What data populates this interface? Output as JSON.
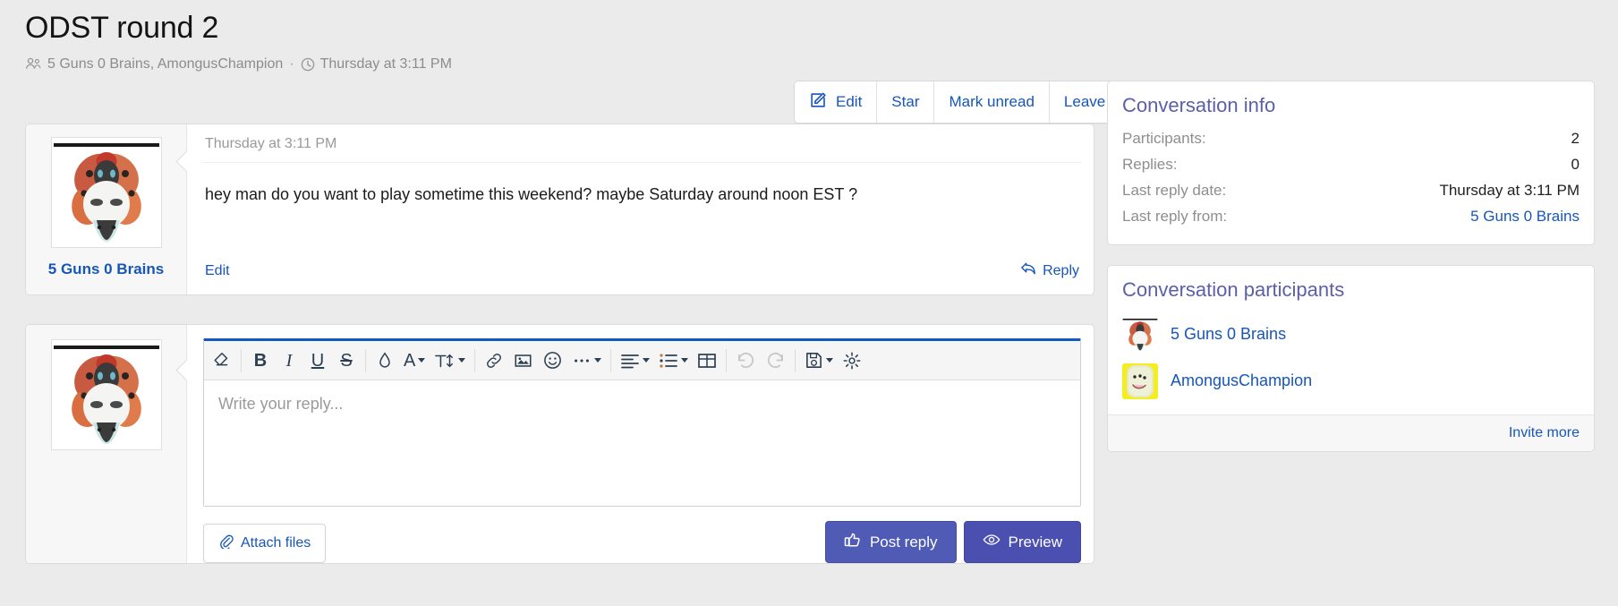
{
  "header": {
    "title": "ODST round 2",
    "participants_icon": "people-icon",
    "participants_text": "5 Guns 0 Brains, AmongusChampion",
    "separator": "·",
    "clock_icon": "clock-icon",
    "timestamp": "Thursday at 3:11 PM"
  },
  "actionbar": {
    "buttons": [
      {
        "label": "Edit",
        "icon": "edit-pencil-icon"
      },
      {
        "label": "Star",
        "icon": ""
      },
      {
        "label": "Mark unread",
        "icon": ""
      },
      {
        "label": "Leave",
        "icon": ""
      }
    ]
  },
  "message": {
    "author": "5 Guns 0 Brains",
    "avatar": "volcarona-moth-avatar",
    "date": "Thursday at 3:11 PM",
    "text": "hey man do you want to play sometime this weekend? maybe Saturday around noon EST ?",
    "edit_label": "Edit",
    "reply_label": "Reply",
    "reply_icon": "reply-arrow-icon"
  },
  "reply_editor": {
    "avatar": "volcarona-moth-avatar",
    "placeholder": "Write your reply...",
    "toolbar": [
      {
        "name": "remove-formatting-icon",
        "glyph": "eraser",
        "caret": false
      },
      {
        "name": "bold-icon",
        "glyph": "B",
        "caret": false
      },
      {
        "name": "italic-icon",
        "glyph": "I",
        "caret": false
      },
      {
        "name": "underline-icon",
        "glyph": "U",
        "caret": false
      },
      {
        "name": "strikethrough-icon",
        "glyph": "S",
        "caret": false
      },
      {
        "name": "text-color-icon",
        "glyph": "droplet",
        "caret": false
      },
      {
        "name": "font-family-icon",
        "glyph": "A",
        "caret": true
      },
      {
        "name": "font-size-icon",
        "glyph": "T",
        "caret": true
      },
      {
        "name": "insert-link-icon",
        "glyph": "link",
        "caret": false
      },
      {
        "name": "insert-image-icon",
        "glyph": "image",
        "caret": false
      },
      {
        "name": "insert-smilie-icon",
        "glyph": "smiley",
        "caret": false
      },
      {
        "name": "more-options-icon",
        "glyph": "ellipsis",
        "caret": true
      },
      {
        "name": "text-align-icon",
        "glyph": "align",
        "caret": true
      },
      {
        "name": "list-icon",
        "glyph": "list",
        "caret": true
      },
      {
        "name": "insert-table-icon",
        "glyph": "table",
        "caret": false
      },
      {
        "name": "undo-icon",
        "glyph": "undo",
        "caret": false,
        "disabled": true
      },
      {
        "name": "redo-icon",
        "glyph": "redo",
        "caret": false,
        "disabled": true
      },
      {
        "name": "drafts-icon",
        "glyph": "floppy",
        "caret": true
      },
      {
        "name": "editor-settings-icon",
        "glyph": "gear",
        "caret": false
      }
    ],
    "attach_label": "Attach files",
    "attach_icon": "paperclip-icon",
    "post_label": "Post reply",
    "post_icon": "thumbs-up-icon",
    "preview_label": "Preview",
    "preview_icon": "eye-icon"
  },
  "sidebar": {
    "info_card": {
      "title": "Conversation info",
      "rows": [
        {
          "key": "Participants:",
          "value": "2",
          "is_link": false
        },
        {
          "key": "Replies:",
          "value": "0",
          "is_link": false
        },
        {
          "key": "Last reply date:",
          "value": "Thursday at 3:11 PM",
          "is_link": false
        },
        {
          "key": "Last reply from:",
          "value": "5 Guns 0 Brains",
          "is_link": true
        }
      ]
    },
    "participants_card": {
      "title": "Conversation participants",
      "members": [
        {
          "name": "5 Guns 0 Brains",
          "avatar": "volcarona-moth-avatar"
        },
        {
          "name": "AmongusChampion",
          "avatar": "yellow-roblox-face-avatar"
        }
      ],
      "invite_label": "Invite more"
    }
  },
  "colors": {
    "link": "#1756b8",
    "heading_purple": "#5b5fa9",
    "editor_accent": "#1558c0",
    "primary_button": "#4f5bb5",
    "page_background": "#ebebeb"
  }
}
